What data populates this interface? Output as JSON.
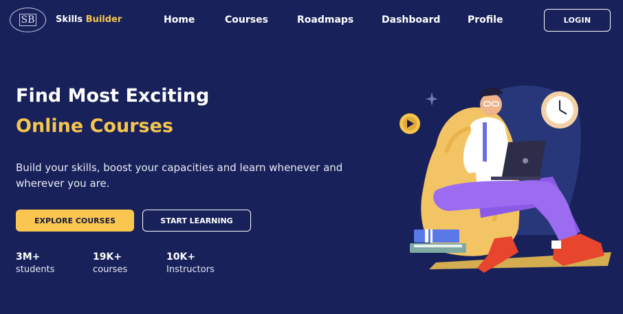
{
  "nav": {
    "logo_monogram": "SB",
    "brand_part1": "Skills",
    "brand_part2": "Builder",
    "links": [
      "Home",
      "Courses",
      "Roadmaps",
      "Dashboard",
      "Profile"
    ],
    "login_label": "LOGIN"
  },
  "hero": {
    "title_line1": "Find Most Exciting",
    "title_line2": "Online Courses",
    "description": "Build your skills, boost your capacities and learn whenever and wherever you are.",
    "primary_button": "EXPLORE COURSES",
    "secondary_button": "START LEARNING",
    "stats": [
      {
        "value": "3M+",
        "label": "students"
      },
      {
        "value": "19K+",
        "label": "courses"
      },
      {
        "value": "10K+",
        "label": "Instructors"
      }
    ]
  },
  "colors": {
    "background": "#18215a",
    "accent": "#f5c64e",
    "text": "#ffffff"
  },
  "icons": [
    "play-coin-icon",
    "sparkle-icon",
    "clock-icon"
  ]
}
